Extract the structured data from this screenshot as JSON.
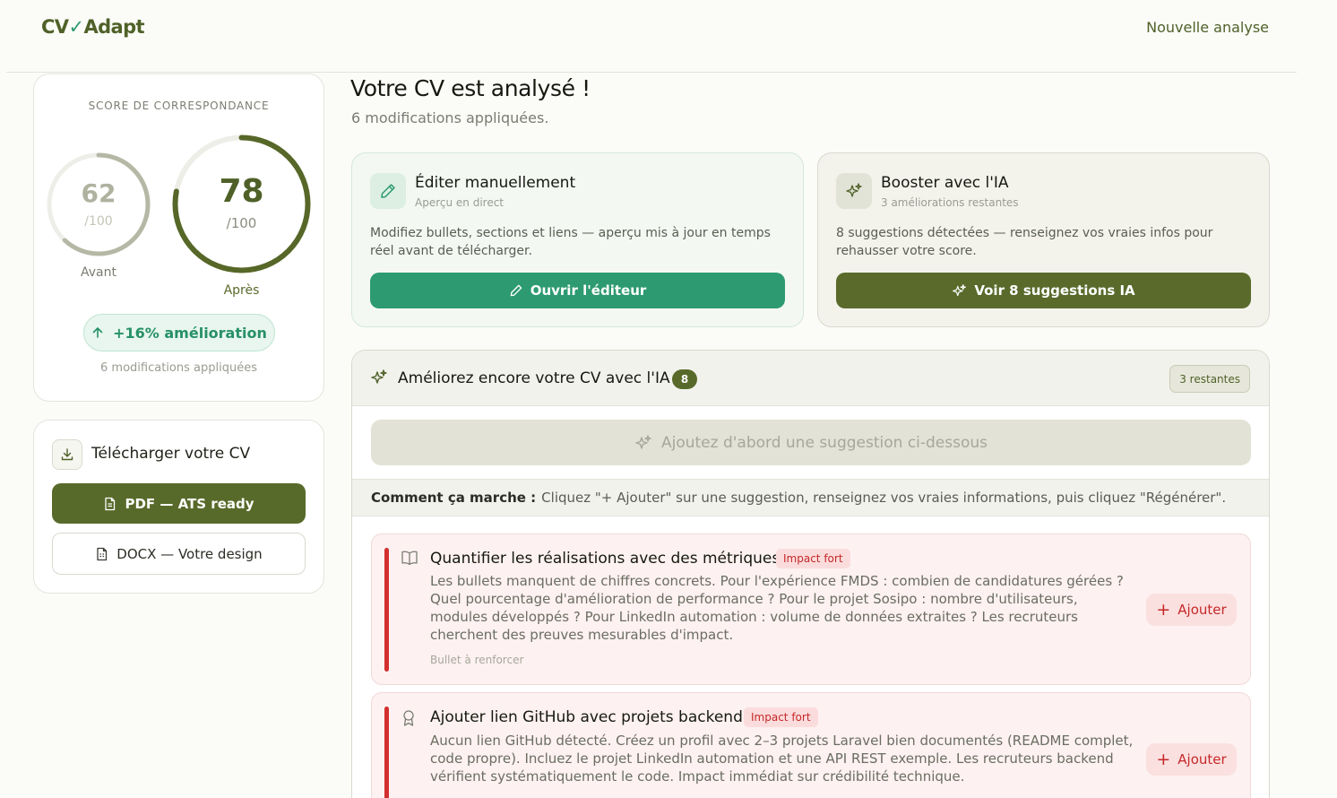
{
  "header": {
    "logo_pre": "CV",
    "logo_tick": "✓",
    "logo_post": "Adapt",
    "nav_new_analysis": "Nouvelle analyse"
  },
  "score": {
    "label": "SCORE DE CORRESPONDANCE",
    "before": {
      "value": "62",
      "max": "/100",
      "caption": "Avant",
      "fraction": 0.62,
      "color": "#b6b8a6"
    },
    "after": {
      "value": "78",
      "max": "/100",
      "caption": "Après",
      "fraction": 0.78,
      "color": "#566728"
    },
    "improvement": "+16% amélioration",
    "modifications": "6 modifications appliquées"
  },
  "download": {
    "title": "Télécharger votre CV",
    "pdf_label": "PDF — ATS ready",
    "docx_label": "DOCX — Votre design"
  },
  "main": {
    "title": "Votre CV est analysé !",
    "subtitle": "6 modifications appliquées."
  },
  "actions": {
    "edit": {
      "title": "Éditer manuellement",
      "subtitle": "Aperçu en direct",
      "description": "Modifiez bullets, sections et liens — aperçu mis à jour en temps réel avant de télécharger.",
      "button": "Ouvrir l'éditeur"
    },
    "ia": {
      "title": "Booster avec l'IA",
      "subtitle": "3 améliorations restantes",
      "description": "8 suggestions détectées — renseignez vos vraies infos pour rehausser votre score.",
      "button": "Voir 8 suggestions IA"
    }
  },
  "improve_panel": {
    "title": "Améliorez encore votre CV avec l'IA",
    "count": "8",
    "remaining": "3 restantes",
    "regenerate_placeholder": "Ajoutez d'abord une suggestion ci-dessous",
    "how_label": "Comment ça marche :",
    "how_text": "Cliquez \"+ Ajouter\" sur une suggestion, renseignez vos vraies informations, puis cliquez \"Régénérer\"."
  },
  "suggestions": [
    {
      "icon": "book-icon",
      "title": "Quantifier les réalisations avec des métriques",
      "tag": "Impact fort",
      "body": "Les bullets manquent de chiffres concrets. Pour l'expérience FMDS : combien de candidatures gérées ? Quel pourcentage d'amélioration de performance ? Pour le projet Sosipo : nombre d'utilisateurs, modules développés ? Pour LinkedIn automation : volume de données extraites ? Les recruteurs cherchent des preuves mesurables d'impact.",
      "meta": "Bullet à renforcer",
      "button": "Ajouter"
    },
    {
      "icon": "award-icon",
      "title": "Ajouter lien GitHub avec projets backend",
      "tag": "Impact fort",
      "body": "Aucun lien GitHub détecté. Créez un profil avec 2–3 projets Laravel bien documentés (README complet, code propre). Incluez le projet LinkedIn automation et une API REST exemple. Les recruteurs backend vérifient systématiquement le code. Impact immédiat sur crédibilité technique.",
      "meta": "",
      "button": "Ajouter"
    }
  ],
  "colors": {
    "olive": "#586a2a",
    "green": "#2d9a72",
    "impact_red": "#c62828"
  }
}
